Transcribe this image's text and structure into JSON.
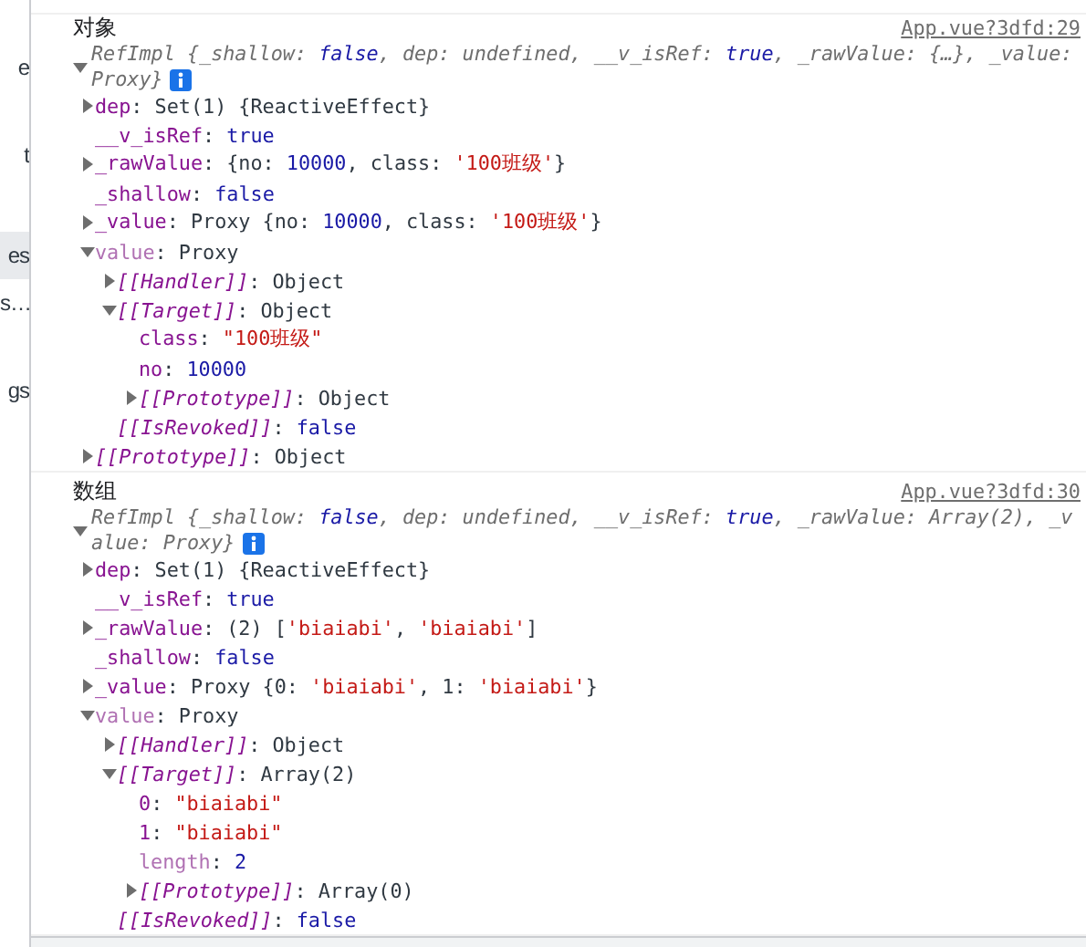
{
  "sidebar": {
    "items": [
      {
        "label": "e",
        "selected": false
      },
      {
        "label": "t",
        "selected": false
      },
      {
        "label": "es",
        "selected": true
      },
      {
        "label": "s…",
        "selected": false
      },
      {
        "label": "gs",
        "selected": false
      }
    ]
  },
  "console": {
    "entries": [
      {
        "label": "对象",
        "source": "App.vue?3dfd:29",
        "expanded": true,
        "summary": [
          {
            "kind": "key",
            "text": "RefImpl {_shallow: "
          },
          {
            "kind": "number",
            "text": "false"
          },
          {
            "kind": "key",
            "text": ", dep: undefined, __v_isRef: "
          },
          {
            "kind": "number",
            "text": "true"
          },
          {
            "kind": "key",
            "text": ", _rawValue: {…}, _value: Proxy}"
          }
        ],
        "children": [
          {
            "key": "dep",
            "kind": "own",
            "expanded": false,
            "value": [
              {
                "kind": "plain",
                "text": ": Set(1) {ReactiveEffect}"
              }
            ]
          },
          {
            "key": "__v_isRef",
            "kind": "own",
            "value": [
              {
                "kind": "plain",
                "text": ": "
              },
              {
                "kind": "number",
                "text": "true"
              }
            ]
          },
          {
            "key": "_rawValue",
            "kind": "own",
            "expanded": false,
            "value": [
              {
                "kind": "plain",
                "text": ": {no: "
              },
              {
                "kind": "number",
                "text": "10000"
              },
              {
                "kind": "plain",
                "text": ", class: "
              },
              {
                "kind": "string",
                "text": "'100班级'"
              },
              {
                "kind": "plain",
                "text": "}"
              }
            ]
          },
          {
            "key": "_shallow",
            "kind": "own",
            "value": [
              {
                "kind": "plain",
                "text": ": "
              },
              {
                "kind": "number",
                "text": "false"
              }
            ]
          },
          {
            "key": "_value",
            "kind": "own",
            "expanded": false,
            "value": [
              {
                "kind": "plain",
                "text": ": Proxy {no: "
              },
              {
                "kind": "number",
                "text": "10000"
              },
              {
                "kind": "plain",
                "text": ", class: "
              },
              {
                "kind": "string",
                "text": "'100班级'"
              },
              {
                "kind": "plain",
                "text": "}"
              }
            ]
          },
          {
            "key": "value",
            "kind": "dim",
            "expanded": true,
            "value": [
              {
                "kind": "plain",
                "text": ": Proxy"
              }
            ],
            "children": [
              {
                "key": "[[Handler]]",
                "kind": "internal",
                "expanded": false,
                "value": [
                  {
                    "kind": "plain",
                    "text": ": Object"
                  }
                ]
              },
              {
                "key": "[[Target]]",
                "kind": "internal",
                "expanded": true,
                "value": [
                  {
                    "kind": "plain",
                    "text": ": Object"
                  }
                ],
                "children": [
                  {
                    "key": "class",
                    "kind": "own",
                    "value": [
                      {
                        "kind": "plain",
                        "text": ": "
                      },
                      {
                        "kind": "string",
                        "text": "\"100班级\""
                      }
                    ]
                  },
                  {
                    "key": "no",
                    "kind": "own",
                    "value": [
                      {
                        "kind": "plain",
                        "text": ": "
                      },
                      {
                        "kind": "number",
                        "text": "10000"
                      }
                    ]
                  },
                  {
                    "key": "[[Prototype]]",
                    "kind": "internal",
                    "expanded": false,
                    "value": [
                      {
                        "kind": "plain",
                        "text": ": Object"
                      }
                    ]
                  }
                ]
              },
              {
                "key": "[[IsRevoked]]",
                "kind": "internal",
                "value": [
                  {
                    "kind": "plain",
                    "text": ": "
                  },
                  {
                    "kind": "number",
                    "text": "false"
                  }
                ]
              }
            ]
          },
          {
            "key": "[[Prototype]]",
            "kind": "internal",
            "expanded": false,
            "value": [
              {
                "kind": "plain",
                "text": ": Object"
              }
            ]
          }
        ]
      },
      {
        "label": "数组",
        "source": "App.vue?3dfd:30",
        "expanded": true,
        "summary": [
          {
            "kind": "key",
            "text": "RefImpl {_shallow: "
          },
          {
            "kind": "number",
            "text": "false"
          },
          {
            "kind": "key",
            "text": ", dep: undefined, __v_isRef: "
          },
          {
            "kind": "number",
            "text": "true"
          },
          {
            "kind": "key",
            "text": ", _rawValue: Array(2), _value: Proxy}"
          }
        ],
        "children": [
          {
            "key": "dep",
            "kind": "own",
            "expanded": false,
            "value": [
              {
                "kind": "plain",
                "text": ": Set(1) {ReactiveEffect}"
              }
            ]
          },
          {
            "key": "__v_isRef",
            "kind": "own",
            "value": [
              {
                "kind": "plain",
                "text": ": "
              },
              {
                "kind": "number",
                "text": "true"
              }
            ]
          },
          {
            "key": "_rawValue",
            "kind": "own",
            "expanded": false,
            "value": [
              {
                "kind": "plain",
                "text": ": (2) ["
              },
              {
                "kind": "string",
                "text": "'biaiabi'"
              },
              {
                "kind": "plain",
                "text": ", "
              },
              {
                "kind": "string",
                "text": "'biaiabi'"
              },
              {
                "kind": "plain",
                "text": "]"
              }
            ]
          },
          {
            "key": "_shallow",
            "kind": "own",
            "value": [
              {
                "kind": "plain",
                "text": ": "
              },
              {
                "kind": "number",
                "text": "false"
              }
            ]
          },
          {
            "key": "_value",
            "kind": "own",
            "expanded": false,
            "value": [
              {
                "kind": "plain",
                "text": ": Proxy {0: "
              },
              {
                "kind": "string",
                "text": "'biaiabi'"
              },
              {
                "kind": "plain",
                "text": ", 1: "
              },
              {
                "kind": "string",
                "text": "'biaiabi'"
              },
              {
                "kind": "plain",
                "text": "}"
              }
            ]
          },
          {
            "key": "value",
            "kind": "dim",
            "expanded": true,
            "value": [
              {
                "kind": "plain",
                "text": ": Proxy"
              }
            ],
            "children": [
              {
                "key": "[[Handler]]",
                "kind": "internal",
                "expanded": false,
                "value": [
                  {
                    "kind": "plain",
                    "text": ": Object"
                  }
                ]
              },
              {
                "key": "[[Target]]",
                "kind": "internal",
                "expanded": true,
                "value": [
                  {
                    "kind": "plain",
                    "text": ": Array(2)"
                  }
                ],
                "children": [
                  {
                    "key": "0",
                    "kind": "own",
                    "value": [
                      {
                        "kind": "plain",
                        "text": ": "
                      },
                      {
                        "kind": "string",
                        "text": "\"biaiabi\""
                      }
                    ]
                  },
                  {
                    "key": "1",
                    "kind": "own",
                    "value": [
                      {
                        "kind": "plain",
                        "text": ": "
                      },
                      {
                        "kind": "string",
                        "text": "\"biaiabi\""
                      }
                    ]
                  },
                  {
                    "key": "length",
                    "kind": "dim",
                    "value": [
                      {
                        "kind": "plain",
                        "text": ": "
                      },
                      {
                        "kind": "number",
                        "text": "2"
                      }
                    ]
                  },
                  {
                    "key": "[[Prototype]]",
                    "kind": "internal",
                    "expanded": false,
                    "value": [
                      {
                        "kind": "plain",
                        "text": ": Array(0)"
                      }
                    ]
                  }
                ]
              },
              {
                "key": "[[IsRevoked]]",
                "kind": "internal",
                "value": [
                  {
                    "kind": "plain",
                    "text": ": "
                  },
                  {
                    "kind": "number",
                    "text": "false"
                  }
                ]
              }
            ]
          }
        ]
      }
    ]
  }
}
